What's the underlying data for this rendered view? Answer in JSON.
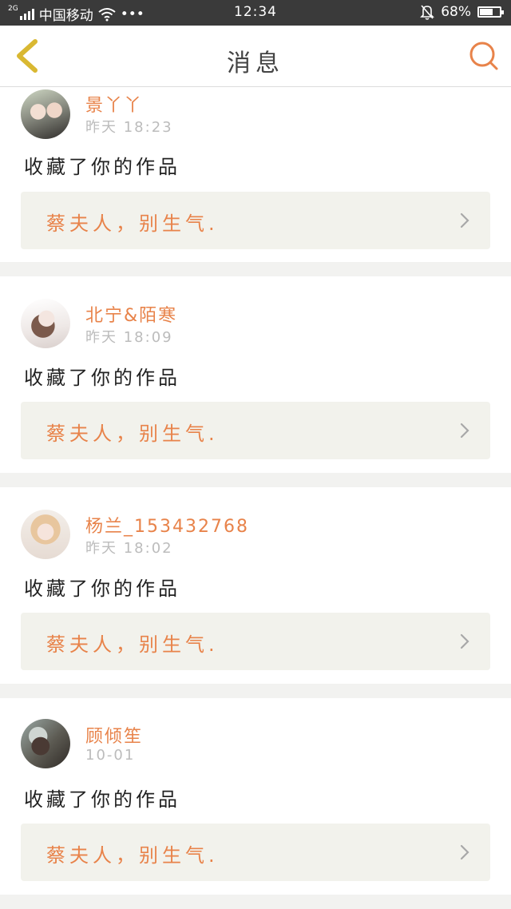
{
  "status_bar": {
    "network_type": "2G",
    "carrier": "中国移动",
    "more": "•••",
    "time": "12:34",
    "battery_percent": "68%",
    "battery_level": 0.68
  },
  "nav": {
    "back_icon": "chevron-left-icon",
    "title": "消息",
    "search_icon": "search-icon",
    "accent_color": "#e8834a"
  },
  "messages": [
    {
      "name": "景丫丫",
      "time": "昨天 18:23",
      "action": "收藏了你的作品",
      "work_title": "蔡夫人，别生气."
    },
    {
      "name": "北宁&陌寒",
      "time": "昨天 18:09",
      "action": "收藏了你的作品",
      "work_title": "蔡夫人，别生气."
    },
    {
      "name": "杨兰_153432768",
      "time": "昨天 18:02",
      "action": "收藏了你的作品",
      "work_title": "蔡夫人，别生气."
    },
    {
      "name": "顾倾笙",
      "time": "10-01",
      "action": "收藏了你的作品",
      "work_title": "蔡夫人，别生气."
    }
  ]
}
